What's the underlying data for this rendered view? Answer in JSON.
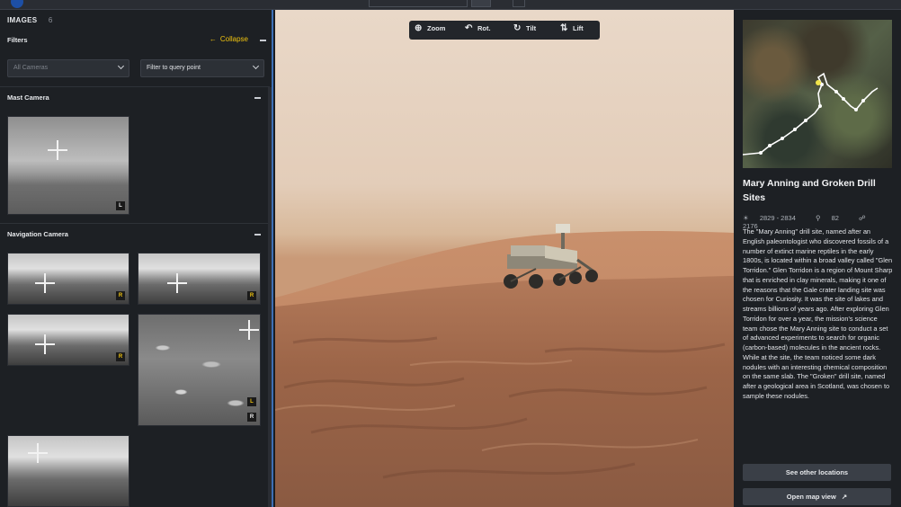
{
  "left_panel": {
    "images_label": "IMAGES",
    "images_count": "6",
    "filters_label": "Filters",
    "collapse_label": "Collapse",
    "camera_select": {
      "value": "All Cameras"
    },
    "filter_select": {
      "value": "Filter to query point"
    },
    "sections": [
      {
        "title": "Mast Camera",
        "thumbnails": [
          {
            "badge": "L"
          }
        ]
      },
      {
        "title": "Navigation Camera",
        "thumbnails": [
          {
            "badge": "R"
          },
          {
            "badge": "R"
          },
          {
            "badge": "R"
          },
          {
            "badge": "L",
            "badge2": "R"
          },
          {
            "badge": ""
          }
        ]
      }
    ]
  },
  "toggles": {
    "left": "«",
    "right": "»"
  },
  "toolbar": {
    "zoom": "Zoom",
    "rotate": "Rot.",
    "tilt": "Tilt",
    "lift": "Lift"
  },
  "location": {
    "title": "Mary Anning and Groken Drill Sites",
    "sols": "2829 - 2834",
    "images": "82",
    "elevation": "2176",
    "description": "The \"Mary Anning\" drill site, named after an English paleontologist who discovered fossils of a number of extinct marine reptiles in the early 1800s, is located within a broad valley called \"Glen Torridon.\" Glen Torridon is a region of Mount Sharp that is enriched in clay minerals, making it one of the reasons that the Gale crater landing site was chosen for Curiosity. It was the site of lakes and streams billions of years ago. After exploring Glen Torridon for over a year, the mission's science team chose the Mary Anning site to conduct a set of advanced experiments to search for organic (carbon-based) molecules in the ancient rocks. While at the site, the team noticed some dark nodules with an interesting chemical composition on the same slab. The \"Groken\" drill site, named after a geological area in Scotland, was chosen to sample these nodules.",
    "see_other_label": "See other locations",
    "open_map_label": "Open map view"
  },
  "colors": {
    "accent": "#f1c40f",
    "panel": "#1d2024",
    "button": "#3a3f47",
    "divider": "#3d6fb5"
  }
}
